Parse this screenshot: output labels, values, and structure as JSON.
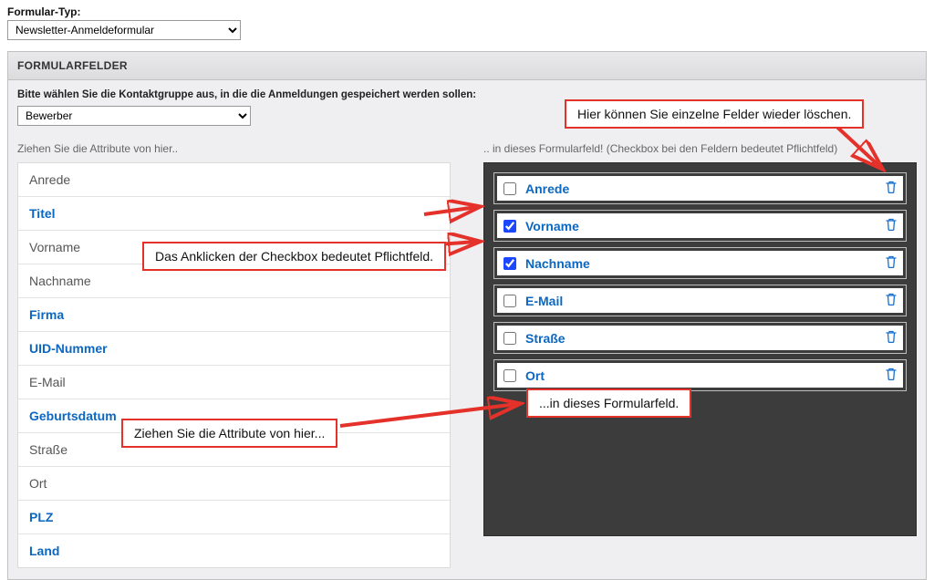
{
  "header": {
    "type_label": "Formular-Typ:",
    "type_value": "Newsletter-Anmeldeformular"
  },
  "panel": {
    "title": "FORMULARFELDER",
    "group_instruction": "Bitte wählen Sie die Kontaktgruppe aus, in die die Anmeldungen gespeichert werden sollen:",
    "group_value": "Bewerber",
    "drag_hint_left": "Ziehen Sie die Attribute von hier..",
    "drag_hint_right": ".. in dieses Formularfeld! (Checkbox bei den Feldern bedeutet Pflichtfeld)"
  },
  "source_attributes": [
    {
      "label": "Anrede",
      "blue": false
    },
    {
      "label": "Titel",
      "blue": true
    },
    {
      "label": "Vorname",
      "blue": false
    },
    {
      "label": "Nachname",
      "blue": false
    },
    {
      "label": "Firma",
      "blue": true
    },
    {
      "label": "UID-Nummer",
      "blue": true
    },
    {
      "label": "E-Mail",
      "blue": false
    },
    {
      "label": "Geburtsdatum",
      "blue": true
    },
    {
      "label": "Straße",
      "blue": false
    },
    {
      "label": "Ort",
      "blue": false
    },
    {
      "label": "PLZ",
      "blue": true
    },
    {
      "label": "Land",
      "blue": true
    }
  ],
  "target_fields": [
    {
      "label": "Anrede",
      "required": false
    },
    {
      "label": "Vorname",
      "required": true
    },
    {
      "label": "Nachname",
      "required": true
    },
    {
      "label": "E-Mail",
      "required": false
    },
    {
      "label": "Straße",
      "required": false
    },
    {
      "label": "Ort",
      "required": false
    }
  ],
  "annotations": {
    "delete_hint": "Hier können Sie einzelne Felder wieder löschen.",
    "checkbox_hint": "Das Anklicken der Checkbox bedeutet Pflichtfeld.",
    "drag_hint_box": "Ziehen Sie die Attribute von hier...",
    "drop_hint_box": "...in dieses Formularfeld."
  }
}
